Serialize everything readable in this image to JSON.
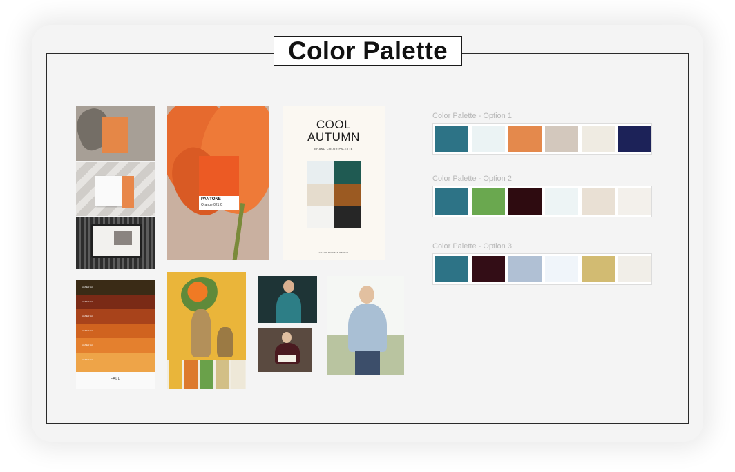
{
  "page": {
    "title": "Color Palette"
  },
  "moodboard": {
    "pantone_card": {
      "brand": "PANTONE",
      "code": "Orange 021 C"
    },
    "cool_autumn": {
      "title_line1": "COOL",
      "title_line2": "AUTUMN",
      "subtitle": "BRAND COLOR PALETTE",
      "footer": "COLOR PALETTE STUDIO",
      "colors": [
        "#e8eef0",
        "#1f5a52",
        "#e5dccd",
        "#9b5a22",
        "#f3f3f1",
        "#262626"
      ]
    },
    "fall_palette": {
      "label": "FALL",
      "stripes": [
        "#3a2b16",
        "#7a2a16",
        "#a8431b",
        "#d0631f",
        "#e4802e",
        "#eea448"
      ]
    },
    "yellow_photo_swatches": [
      "#e9b53a",
      "#dd7a2e",
      "#6aa14a",
      "#d2bf86",
      "#eee8d8"
    ]
  },
  "options": [
    {
      "label": "Color Palette - Option 1",
      "colors": [
        "#2d7386",
        "#ebf3f4",
        "#e4894c",
        "#d3c8bd",
        "#efebe2",
        "#1c2258"
      ]
    },
    {
      "label": "Color Palette - Option 2",
      "colors": [
        "#2d7386",
        "#6aa84f",
        "#2e0b10",
        "#edf4f5",
        "#e9e0d4",
        "#f3f0eb"
      ]
    },
    {
      "label": "Color Palette - Option 3",
      "colors": [
        "#2d7386",
        "#330d16",
        "#b0c0d4",
        "#f0f5fa",
        "#d2bb72",
        "#f1eee8"
      ]
    }
  ]
}
